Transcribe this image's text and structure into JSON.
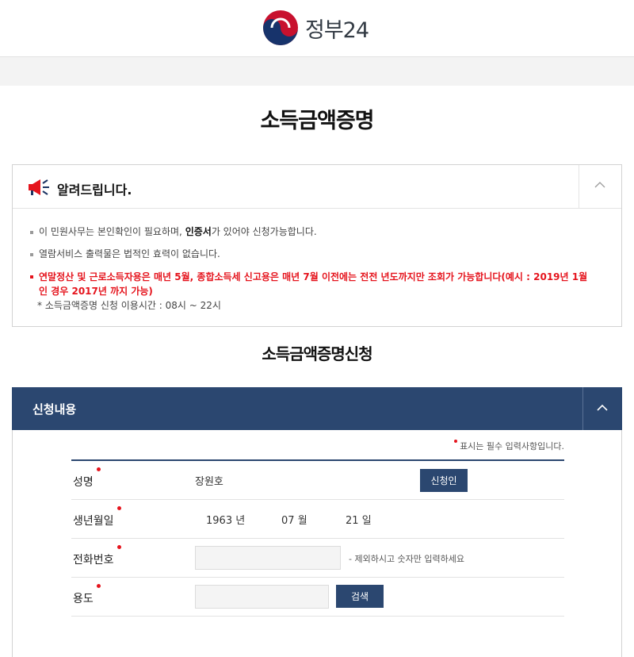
{
  "header": {
    "logo_text": "정부24",
    "logo_icon": "taegeuk-icon"
  },
  "page": {
    "title": "소득금액증명"
  },
  "notice": {
    "title": "알려드립니다.",
    "icon": "megaphone-icon",
    "item1_before": "이 민원사무는 본인확인이 필요하며, ",
    "item1_bold": "인증서",
    "item1_after": "가 있어야 신청가능합니다.",
    "item2": "열람서비스 출력물은 법적인 효력이 없습니다.",
    "item3_line1": "연말정산 및 근로소득자용은 매년 5월, 종합소득세 신고용은 매년 7월 이전에는 전전 년도까지만 조회가 가능합니다(예시 : 2019년 1월",
    "item3_line2": "인 경우 2017년 까지 가능)",
    "sub_note": "* 소득금액증명 신청 이용시간 : 08시 ~ 22시"
  },
  "section": {
    "title": "소득금액증명신청"
  },
  "panel": {
    "title": "신청내용",
    "required_note": "표시는 필수 입력사항입니다.",
    "name_label": "성명",
    "name_value": "장원호",
    "applicant_button": "신청인",
    "birth_label": "생년월일",
    "birth_year": "1963",
    "year_unit": "년",
    "birth_month": "07",
    "month_unit": "월",
    "birth_day": "21",
    "day_unit": "일",
    "phone_label": "전화번호",
    "phone_value": "",
    "phone_hint": "- 제외하시고 숫자만 입력하세요",
    "purpose_label": "용도",
    "purpose_value": "",
    "search_button": "검색"
  },
  "colors": {
    "navy": "#2b4770",
    "alert_red": "#e5141d"
  }
}
